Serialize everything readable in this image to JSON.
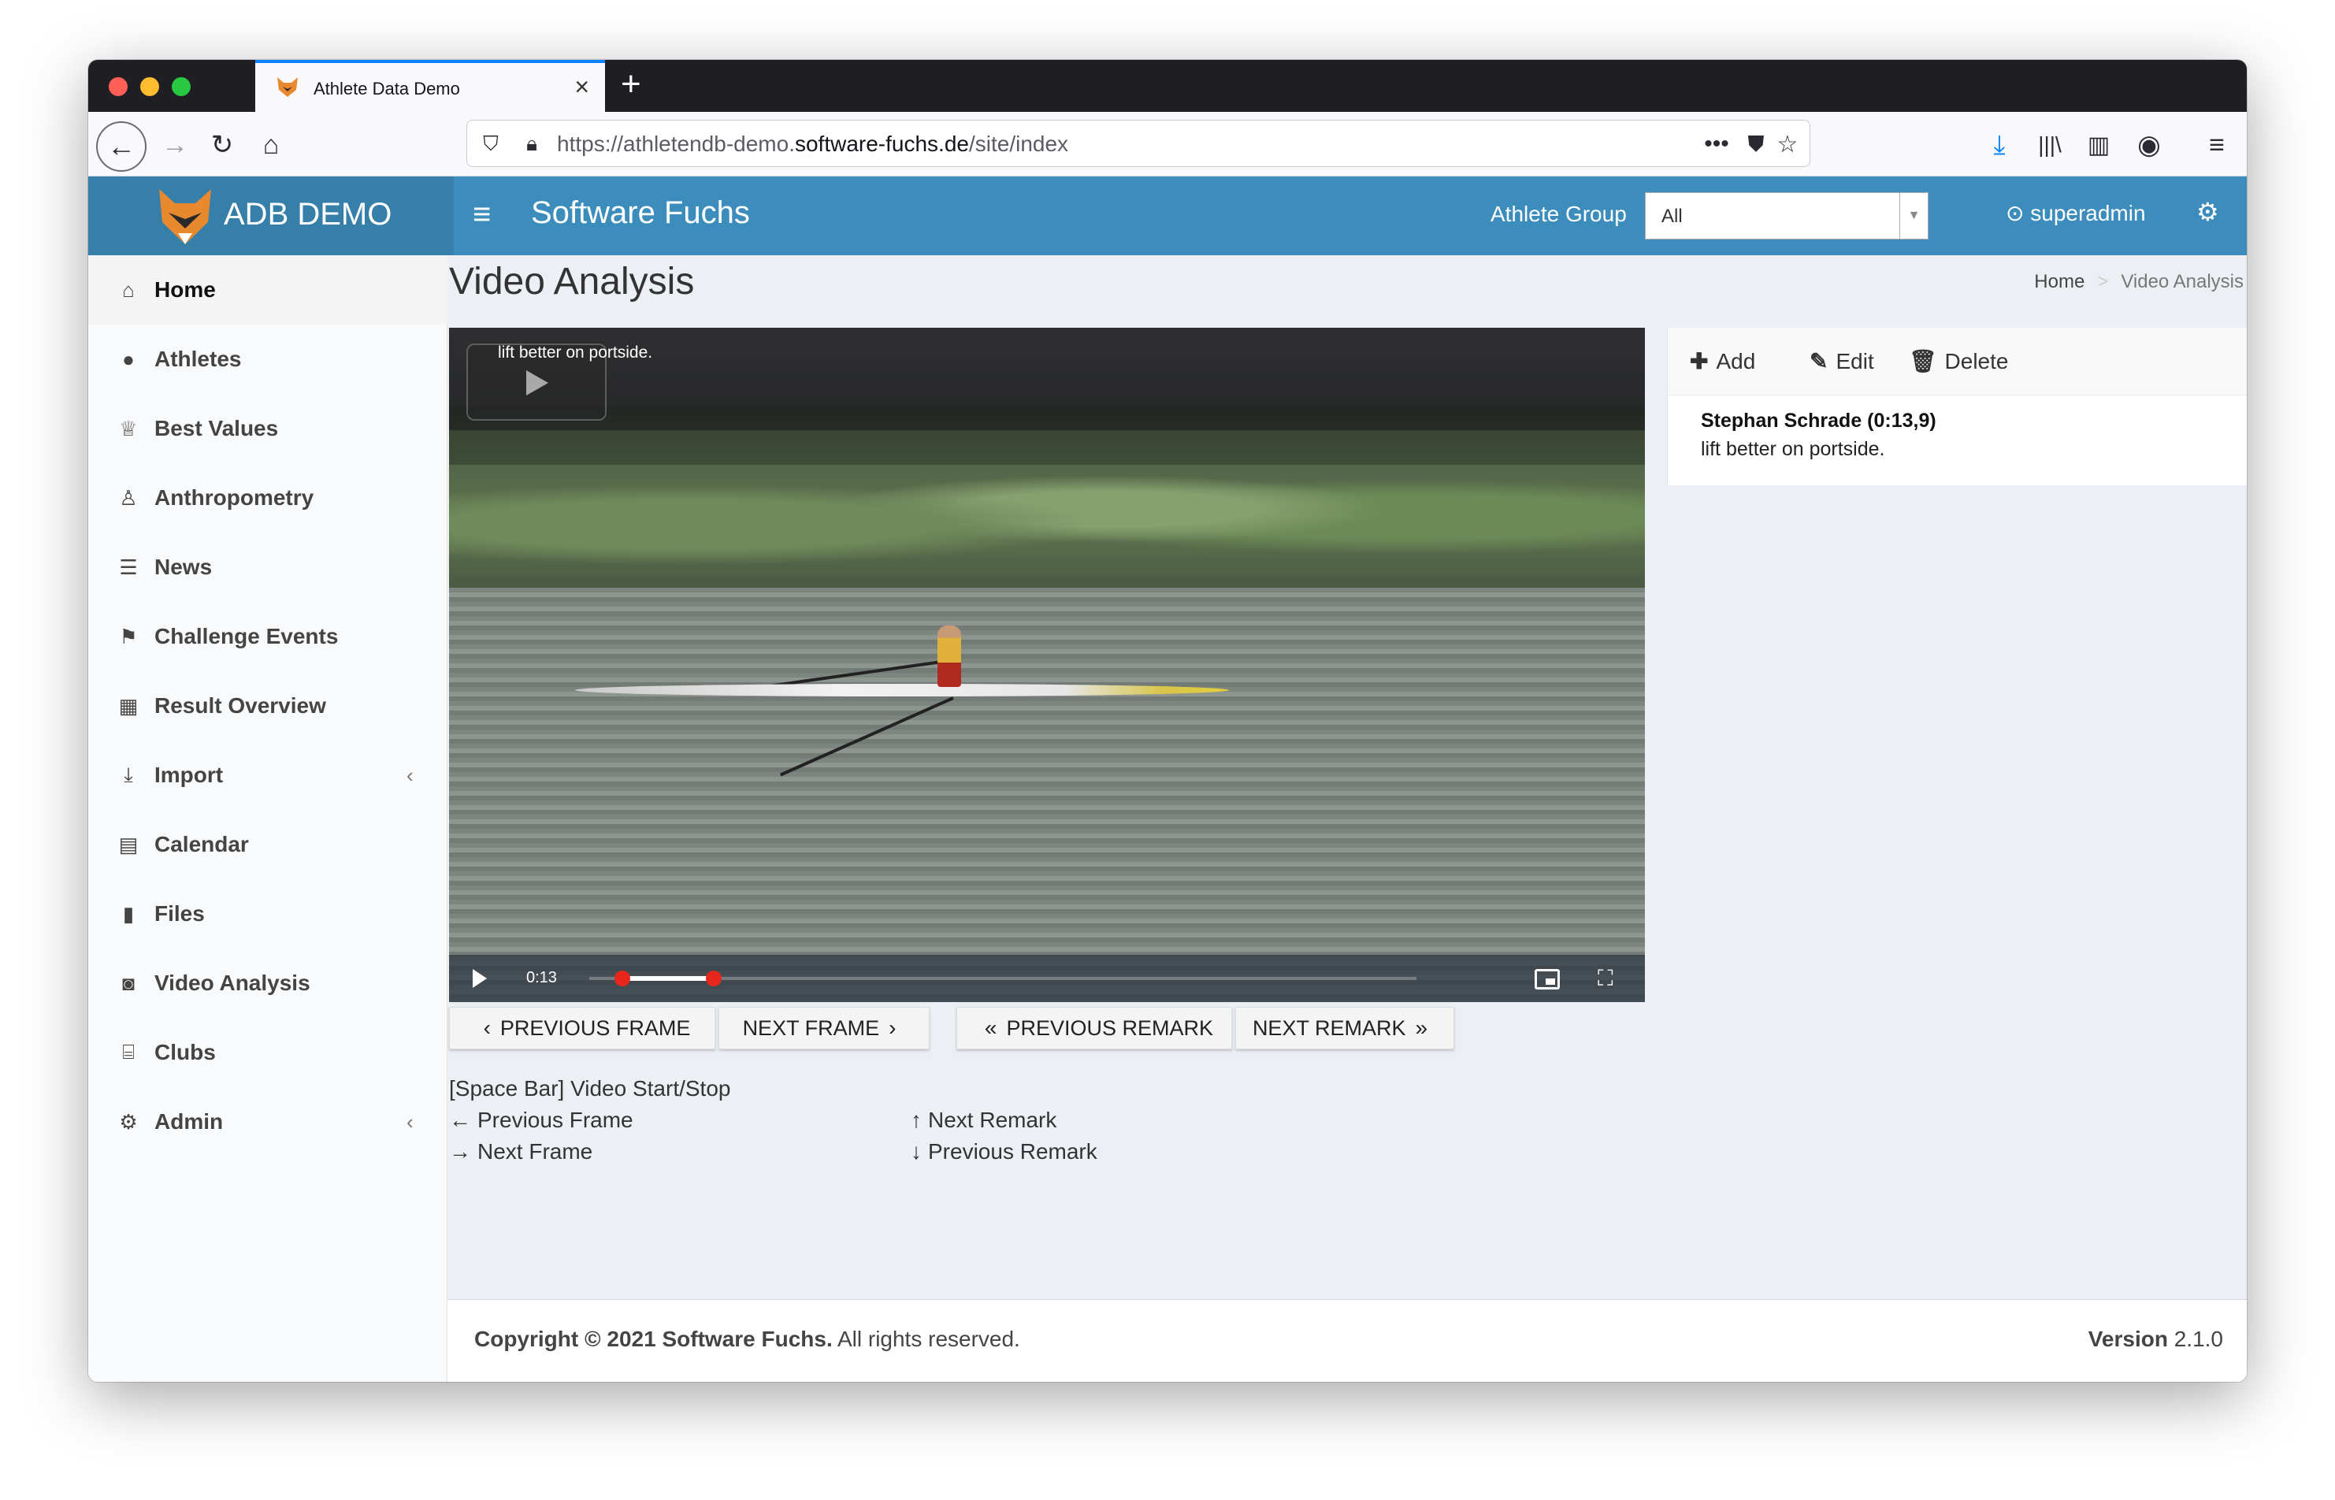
{
  "browser": {
    "tab_title": "Athlete Data Demo",
    "url_prefix": "https://athletendb-demo.",
    "url_domain": "software-fuchs.de",
    "url_path": "/site/index"
  },
  "header": {
    "logo_text": "ADB DEMO",
    "brand": "Software Fuchs",
    "group_label": "Athlete Group",
    "group_value": "All",
    "user": "superadmin"
  },
  "sidebar": {
    "items": [
      {
        "label": "Home",
        "icon": "home-icon"
      },
      {
        "label": "Athletes",
        "icon": "user-icon"
      },
      {
        "label": "Best Values",
        "icon": "trophy-icon"
      },
      {
        "label": "Anthropometry",
        "icon": "person-icon"
      },
      {
        "label": "News",
        "icon": "list-icon"
      },
      {
        "label": "Challenge Events",
        "icon": "flag-icon"
      },
      {
        "label": "Result Overview",
        "icon": "table-icon"
      },
      {
        "label": "Import",
        "icon": "download-icon"
      },
      {
        "label": "Calendar",
        "icon": "calendar-icon"
      },
      {
        "label": "Files",
        "icon": "file-icon"
      },
      {
        "label": "Video Analysis",
        "icon": "camera-icon"
      },
      {
        "label": "Clubs",
        "icon": "bank-icon"
      },
      {
        "label": "Admin",
        "icon": "gears-icon"
      }
    ]
  },
  "main": {
    "title": "Video Analysis",
    "breadcrumb": {
      "home": "Home",
      "current": "Video Analysis"
    },
    "video": {
      "remark_overlay": "lift better on portside.",
      "time": "0:13",
      "range_start": 0.04,
      "range_end": 0.15
    },
    "buttons": {
      "prev_frame": "PREVIOUS FRAME",
      "next_frame": "NEXT FRAME",
      "prev_remark": "PREVIOUS REMARK",
      "next_remark": "NEXT REMARK"
    },
    "shortcuts": {
      "space": "[Space Bar] Video Start/Stop",
      "prev_frame": "Previous Frame",
      "next_frame": "Next Frame",
      "next_remark": "Next Remark",
      "prev_remark": "Previous Remark"
    },
    "remarks": {
      "add": "Add",
      "edit": "Edit",
      "delete": "Delete",
      "author": "Stephan Schrade (0:13,9)",
      "text": "lift better on portside."
    }
  },
  "footer": {
    "copyright_prefix": "Copyright © 2021",
    "company": "Software Fuchs.",
    "rights": "All rights reserved.",
    "version_label": "Version",
    "version": "2.1.0"
  }
}
